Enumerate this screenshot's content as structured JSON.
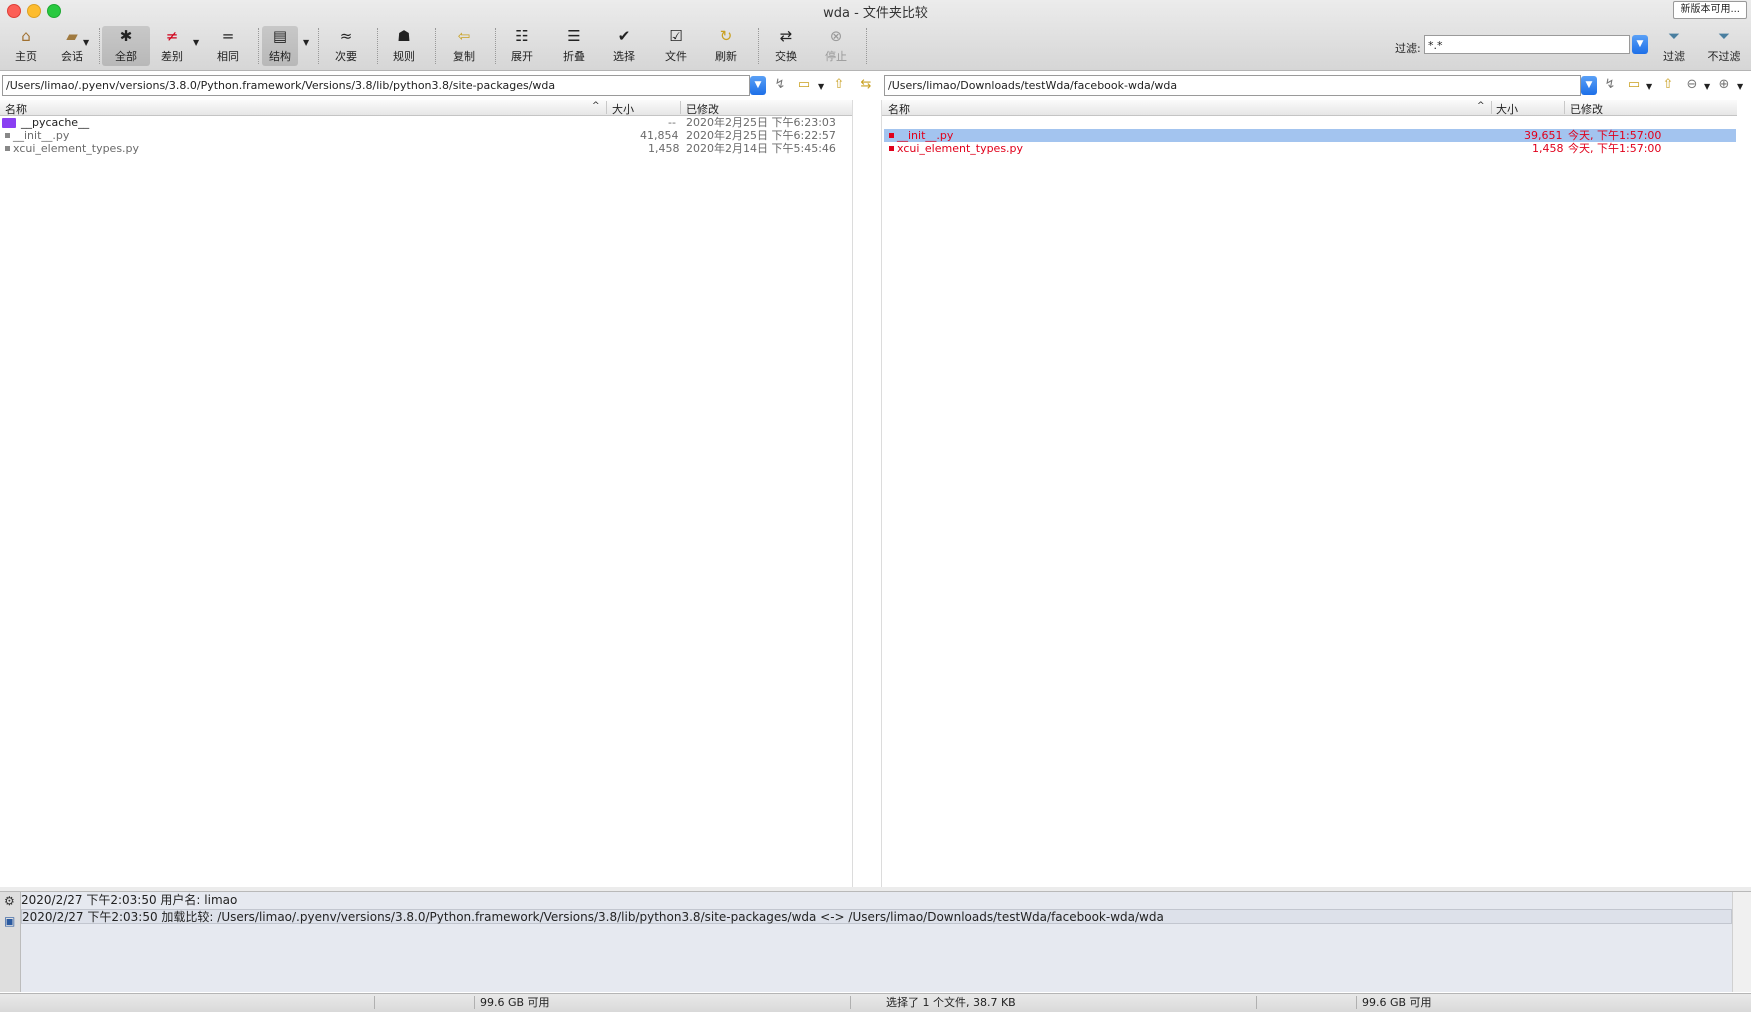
{
  "window": {
    "title": "wda - 文件夹比较",
    "update_button": "新版本可用..."
  },
  "toolbar": {
    "home": "主页",
    "session": "会话",
    "all": "全部",
    "diff": "差别",
    "same": "相同",
    "structure": "结构",
    "minor": "次要",
    "rules": "规则",
    "copy": "复制",
    "expand": "展开",
    "collapse": "折叠",
    "select": "选择",
    "files": "文件",
    "refresh": "刷新",
    "swap": "交换",
    "stop": "停止",
    "filter_label": "过滤:",
    "filter_value": "*.*",
    "filter": "过滤",
    "no_filter": "不过滤"
  },
  "left": {
    "path": "/Users/limao/.pyenv/versions/3.8.0/Python.framework/Versions/3.8/lib/python3.8/site-packages/wda",
    "headers": {
      "name": "名称",
      "size": "大小",
      "modified": "已修改"
    },
    "rows": [
      {
        "name": "__pycache__",
        "size": "--",
        "modified": "2020年2月25日 下午6:23:03"
      },
      {
        "name": "__init__.py",
        "size": "41,854",
        "modified": "2020年2月25日 下午6:22:57"
      },
      {
        "name": "xcui_element_types.py",
        "size": "1,458",
        "modified": "2020年2月14日 下午5:45:46"
      }
    ]
  },
  "right": {
    "path": "/Users/limao/Downloads/testWda/facebook-wda/wda",
    "headers": {
      "name": "名称",
      "size": "大小",
      "modified": "已修改"
    },
    "rows": [
      {
        "name": "__init__.py",
        "size": "39,651",
        "modified": "今天, 下午1:57:00"
      },
      {
        "name": "xcui_element_types.py",
        "size": "1,458",
        "modified": "今天, 下午1:57:00"
      }
    ]
  },
  "log": [
    "2020/2/27 下午2:03:50  用户名: limao",
    "2020/2/27 下午2:03:50  加载比较: /Users/limao/.pyenv/versions/3.8.0/Python.framework/Versions/3.8/lib/python3.8/site-packages/wda <-> /Users/limao/Downloads/testWda/facebook-wda/wda"
  ],
  "status": {
    "left_free": "99.6 GB 可用",
    "selection": "选择了 1 个文件, 38.7 KB",
    "right_free": "99.6 GB 可用"
  },
  "colors": {
    "diff_red": "#e0001b",
    "selection": "#a3c4ef",
    "folder": "#8a3ff2"
  }
}
